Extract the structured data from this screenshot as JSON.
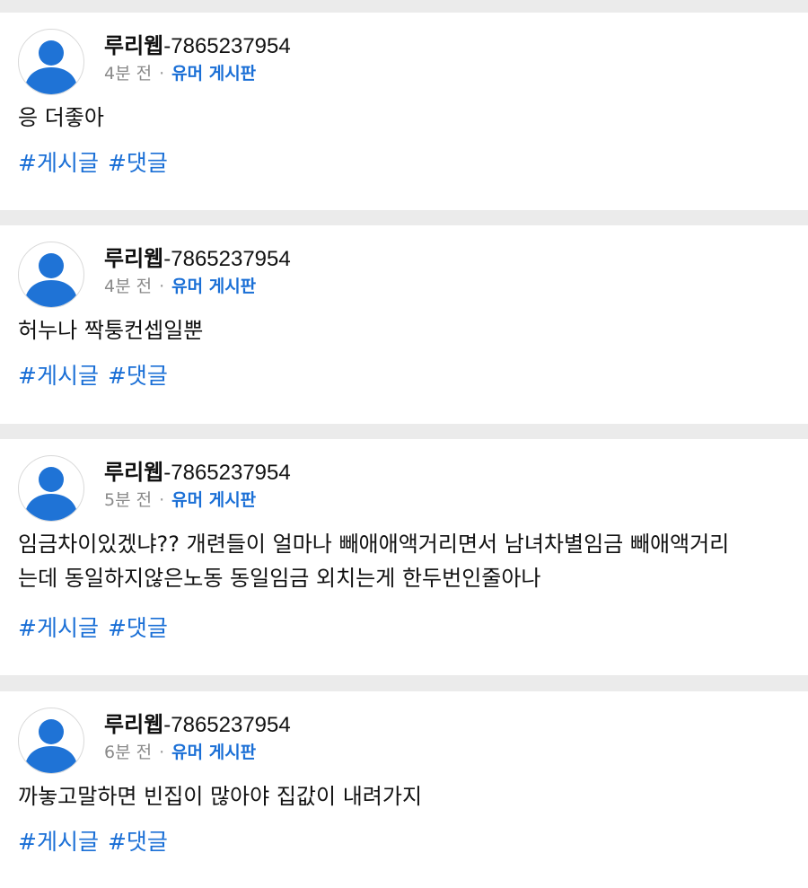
{
  "colors": {
    "background": "#ebebeb",
    "card": "#ffffff",
    "accent": "#1a6fd6",
    "text": "#111111",
    "muted": "#8a8a8a",
    "avatar": "#1f73d6"
  },
  "posts": [
    {
      "nickname": "루리웹",
      "user_id": "-7865237954",
      "time": "4분 전",
      "separator": "·",
      "board": "유머 게시판",
      "avatar_icon": "default-user-avatar-icon",
      "body": "응 더좋아",
      "tags": [
        "#게시글",
        "#댓글"
      ]
    },
    {
      "nickname": "루리웹",
      "user_id": "-7865237954",
      "time": "4분 전",
      "separator": "·",
      "board": "유머 게시판",
      "avatar_icon": "default-user-avatar-icon",
      "body": "허누나 짝퉁컨셉일뿐",
      "tags": [
        "#게시글",
        "#댓글"
      ]
    },
    {
      "nickname": "루리웹",
      "user_id": "-7865237954",
      "time": "5분 전",
      "separator": "·",
      "board": "유머 게시판",
      "avatar_icon": "default-user-avatar-icon",
      "body": "임금차이있겠냐?? 개련들이 얼마나 빼애애액거리면서 남녀차별임금 빼애액거리\n는데 동일하지않은노동 동일임금 외치는게 한두번인줄아나",
      "tags": [
        "#게시글",
        "#댓글"
      ]
    },
    {
      "nickname": "루리웹",
      "user_id": "-7865237954",
      "time": "6분 전",
      "separator": "·",
      "board": "유머 게시판",
      "avatar_icon": "default-user-avatar-icon",
      "body": "까놓고말하면 빈집이 많아야 집값이 내려가지",
      "tags": [
        "#게시글",
        "#댓글"
      ]
    }
  ]
}
